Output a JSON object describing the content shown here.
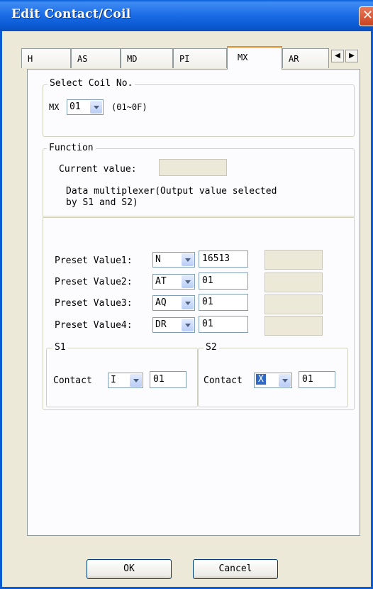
{
  "window": {
    "title": "Edit Contact/Coil"
  },
  "tabs": [
    {
      "label": "H"
    },
    {
      "label": "AS"
    },
    {
      "label": "MD"
    },
    {
      "label": "PI"
    },
    {
      "label": "MX",
      "active": true
    },
    {
      "label": "AR"
    }
  ],
  "tab_scroll": {
    "left": "◀",
    "right": "▶"
  },
  "select_coil": {
    "legend": "Select Coil No.",
    "prefix": "MX",
    "coil_value": "01",
    "range": "(01~0F)"
  },
  "function": {
    "legend": "Function",
    "current_value_label": "Current value:",
    "current_value": "",
    "description_line1": "Data multiplexer(Output value selected",
    "description_line2": "by S1 and S2)"
  },
  "presets": [
    {
      "label": "Preset Value1:",
      "type": "N",
      "value": "16513",
      "extra": ""
    },
    {
      "label": "Preset Value2:",
      "type": "AT",
      "value": "01",
      "extra": ""
    },
    {
      "label": "Preset Value3:",
      "type": "AQ",
      "value": "01",
      "extra": ""
    },
    {
      "label": "Preset Value4:",
      "type": "DR",
      "value": "01",
      "extra": ""
    }
  ],
  "s1": {
    "legend": "S1",
    "contact_label": "Contact",
    "type": "I",
    "value": "01"
  },
  "s2": {
    "legend": "S2",
    "contact_label": "Contact",
    "type": "X",
    "value": "01"
  },
  "buttons": {
    "ok": "OK",
    "cancel": "Cancel"
  },
  "colors": {
    "titlebar": "#0b5bd5",
    "dialog_bg": "#ece9d8",
    "active_tab_accent": "#e68b2c",
    "selection": "#316ac5"
  }
}
